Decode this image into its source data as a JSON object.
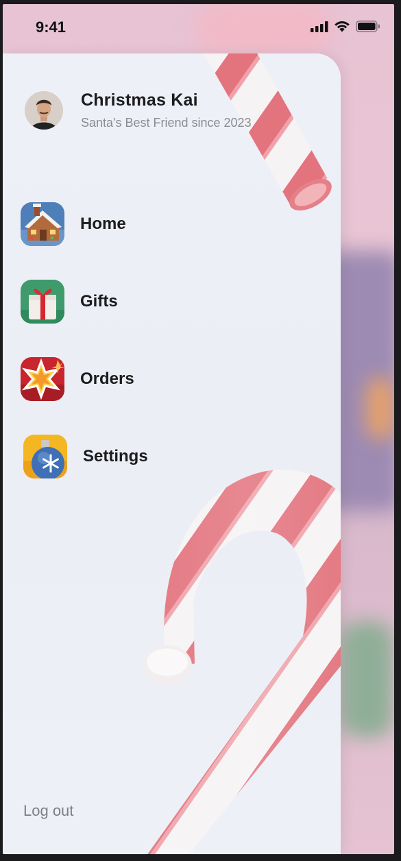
{
  "status_bar": {
    "time": "9:41"
  },
  "profile": {
    "name": "Christmas Kai",
    "subtitle": "Santa's Best Friend since 2023"
  },
  "menu": {
    "items": [
      {
        "label": "Home",
        "icon": "gingerbread-house-icon"
      },
      {
        "label": "Gifts",
        "icon": "gift-box-icon"
      },
      {
        "label": "Orders",
        "icon": "star-burst-icon"
      },
      {
        "label": "Settings",
        "icon": "ornament-icon"
      }
    ]
  },
  "logout_label": "Log out",
  "colors": {
    "drawer_bg": "#eef0f8",
    "cane_red": "#e3727c",
    "cane_white": "#f7f5f6",
    "backdrop_pink": "#e7c3d3"
  }
}
